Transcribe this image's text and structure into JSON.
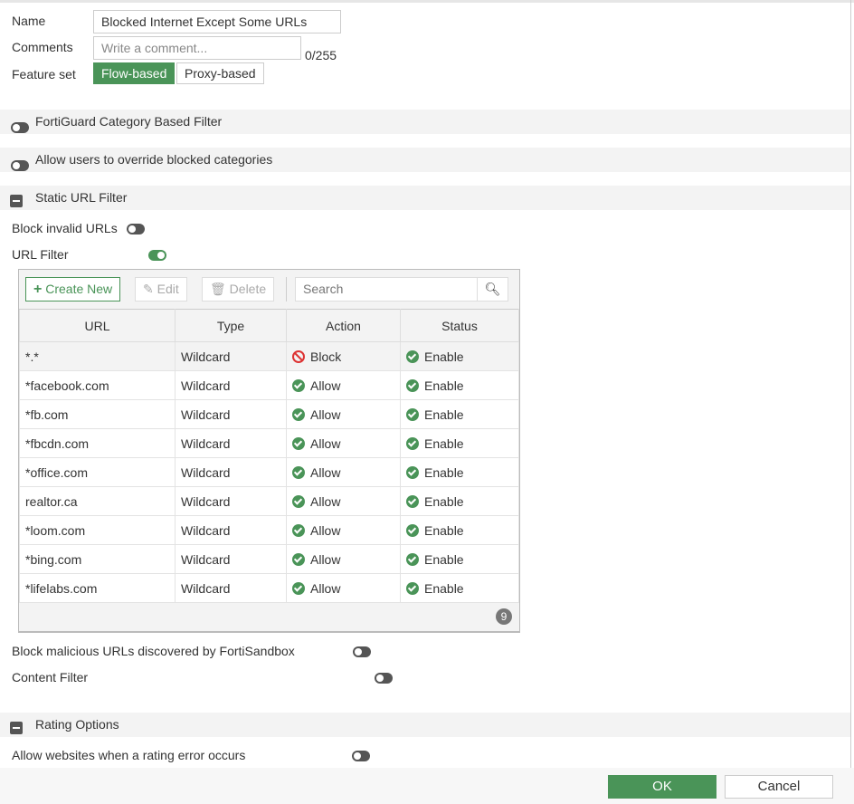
{
  "form": {
    "name_label": "Name",
    "name_value": "Blocked Internet Except Some URLs",
    "comments_label": "Comments",
    "comments_placeholder": "Write a comment...",
    "comments_count": "0/255",
    "feature_label": "Feature set",
    "feature_options": [
      "Flow-based",
      "Proxy-based"
    ],
    "feature_selected": "Flow-based"
  },
  "sections": {
    "fortiguard": "FortiGuard Category Based Filter",
    "override": "Allow users to override blocked categories",
    "static": "Static URL Filter",
    "rating": "Rating Options"
  },
  "settings": {
    "block_invalid": "Block invalid URLs",
    "url_filter": "URL Filter",
    "block_malicious": "Block malicious URLs discovered by FortiSandbox",
    "content_filter": "Content Filter",
    "rating_error": "Allow websites when a rating error occurs"
  },
  "toolbar": {
    "create": "Create New",
    "edit": "Edit",
    "delete": "Delete",
    "search_placeholder": "Search"
  },
  "table": {
    "headers": [
      "URL",
      "Type",
      "Action",
      "Status"
    ],
    "rows": [
      {
        "url": "*.*",
        "type": "Wildcard",
        "action": "Block",
        "status": "Enable"
      },
      {
        "url": "*facebook.com",
        "type": "Wildcard",
        "action": "Allow",
        "status": "Enable"
      },
      {
        "url": "*fb.com",
        "type": "Wildcard",
        "action": "Allow",
        "status": "Enable"
      },
      {
        "url": "*fbcdn.com",
        "type": "Wildcard",
        "action": "Allow",
        "status": "Enable"
      },
      {
        "url": "*office.com",
        "type": "Wildcard",
        "action": "Allow",
        "status": "Enable"
      },
      {
        "url": "realtor.ca",
        "type": "Wildcard",
        "action": "Allow",
        "status": "Enable"
      },
      {
        "url": "*loom.com",
        "type": "Wildcard",
        "action": "Allow",
        "status": "Enable"
      },
      {
        "url": "*bing.com",
        "type": "Wildcard",
        "action": "Allow",
        "status": "Enable"
      },
      {
        "url": "*lifelabs.com",
        "type": "Wildcard",
        "action": "Allow",
        "status": "Enable"
      }
    ],
    "count": "9"
  },
  "footer": {
    "ok": "OK",
    "cancel": "Cancel"
  },
  "colors": {
    "accent": "#4a9458",
    "block": "#dd3333"
  }
}
